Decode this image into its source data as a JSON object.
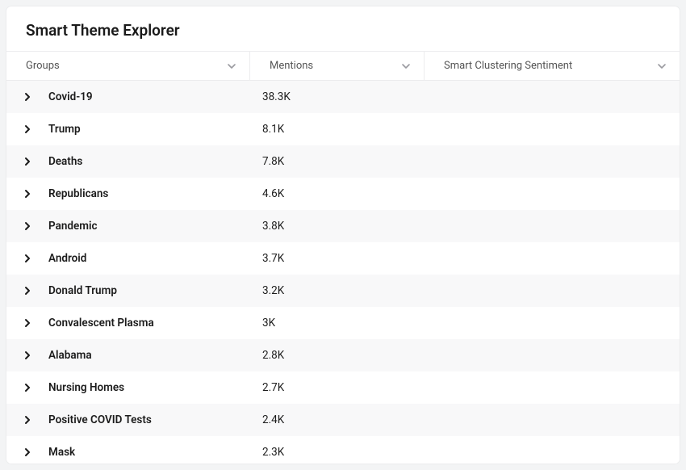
{
  "panel": {
    "title": "Smart Theme Explorer"
  },
  "columns": {
    "groups": "Groups",
    "mentions": "Mentions",
    "sentiment": "Smart Clustering Sentiment"
  },
  "rows": [
    {
      "group": "Covid-19",
      "mentions": "38.3K"
    },
    {
      "group": "Trump",
      "mentions": "8.1K"
    },
    {
      "group": "Deaths",
      "mentions": "7.8K"
    },
    {
      "group": "Republicans",
      "mentions": "4.6K"
    },
    {
      "group": "Pandemic",
      "mentions": "3.8K"
    },
    {
      "group": "Android",
      "mentions": "3.7K"
    },
    {
      "group": "Donald Trump",
      "mentions": "3.2K"
    },
    {
      "group": "Convalescent Plasma",
      "mentions": "3K"
    },
    {
      "group": "Alabama",
      "mentions": "2.8K"
    },
    {
      "group": "Nursing Homes",
      "mentions": "2.7K"
    },
    {
      "group": "Positive COVID Tests",
      "mentions": "2.4K"
    },
    {
      "group": "Mask",
      "mentions": "2.3K"
    }
  ]
}
